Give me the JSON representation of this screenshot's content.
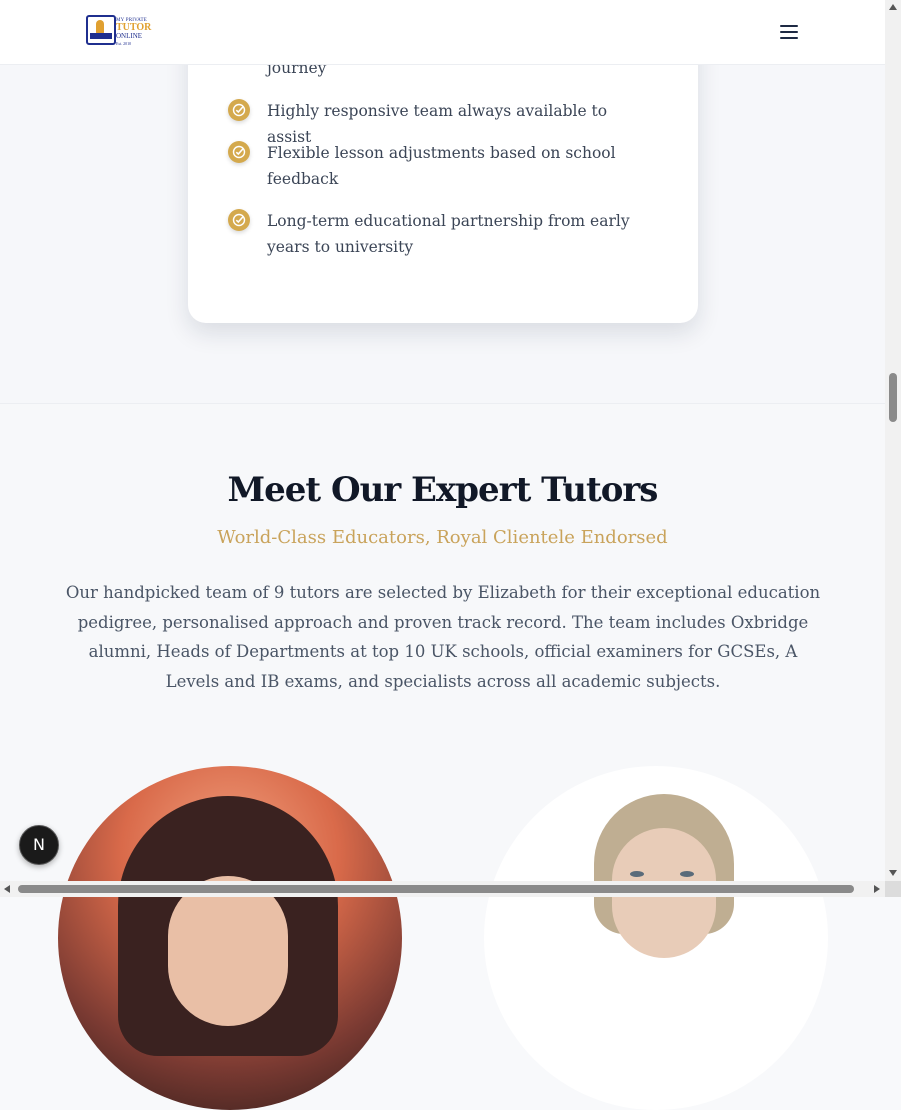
{
  "header": {
    "logo": {
      "line1": "MY PRIVATE",
      "line2": "TUTOR",
      "line3": "ONLINE",
      "line4": "Est. 2010"
    },
    "menu_icon": "hamburger-menu-icon"
  },
  "card": {
    "features": [
      {
        "text": "journey"
      },
      {
        "text": "Highly responsive team always available to assist"
      },
      {
        "text": "Flexible lesson adjustments based on school feedback"
      },
      {
        "text": "Long-term educational partnership from early years to university"
      }
    ],
    "check_icon": "check-circle-icon",
    "accent": "#d4a94d"
  },
  "tutors": {
    "title": "Meet Our Expert Tutors",
    "subtitle": "World-Class Educators, Royal Clientele Endorsed",
    "description": "Our handpicked team of 9 tutors are selected by Elizabeth for their exceptional education pedigree, personalised approach and proven track record. The team includes Oxbridge alumni, Heads of Departments at top 10 UK schools, official examiners for GCSEs, A Levels and IB exams, and specialists across all academic subjects.",
    "subtitle_color": "#c9a35b"
  },
  "badge": {
    "label": "N"
  }
}
